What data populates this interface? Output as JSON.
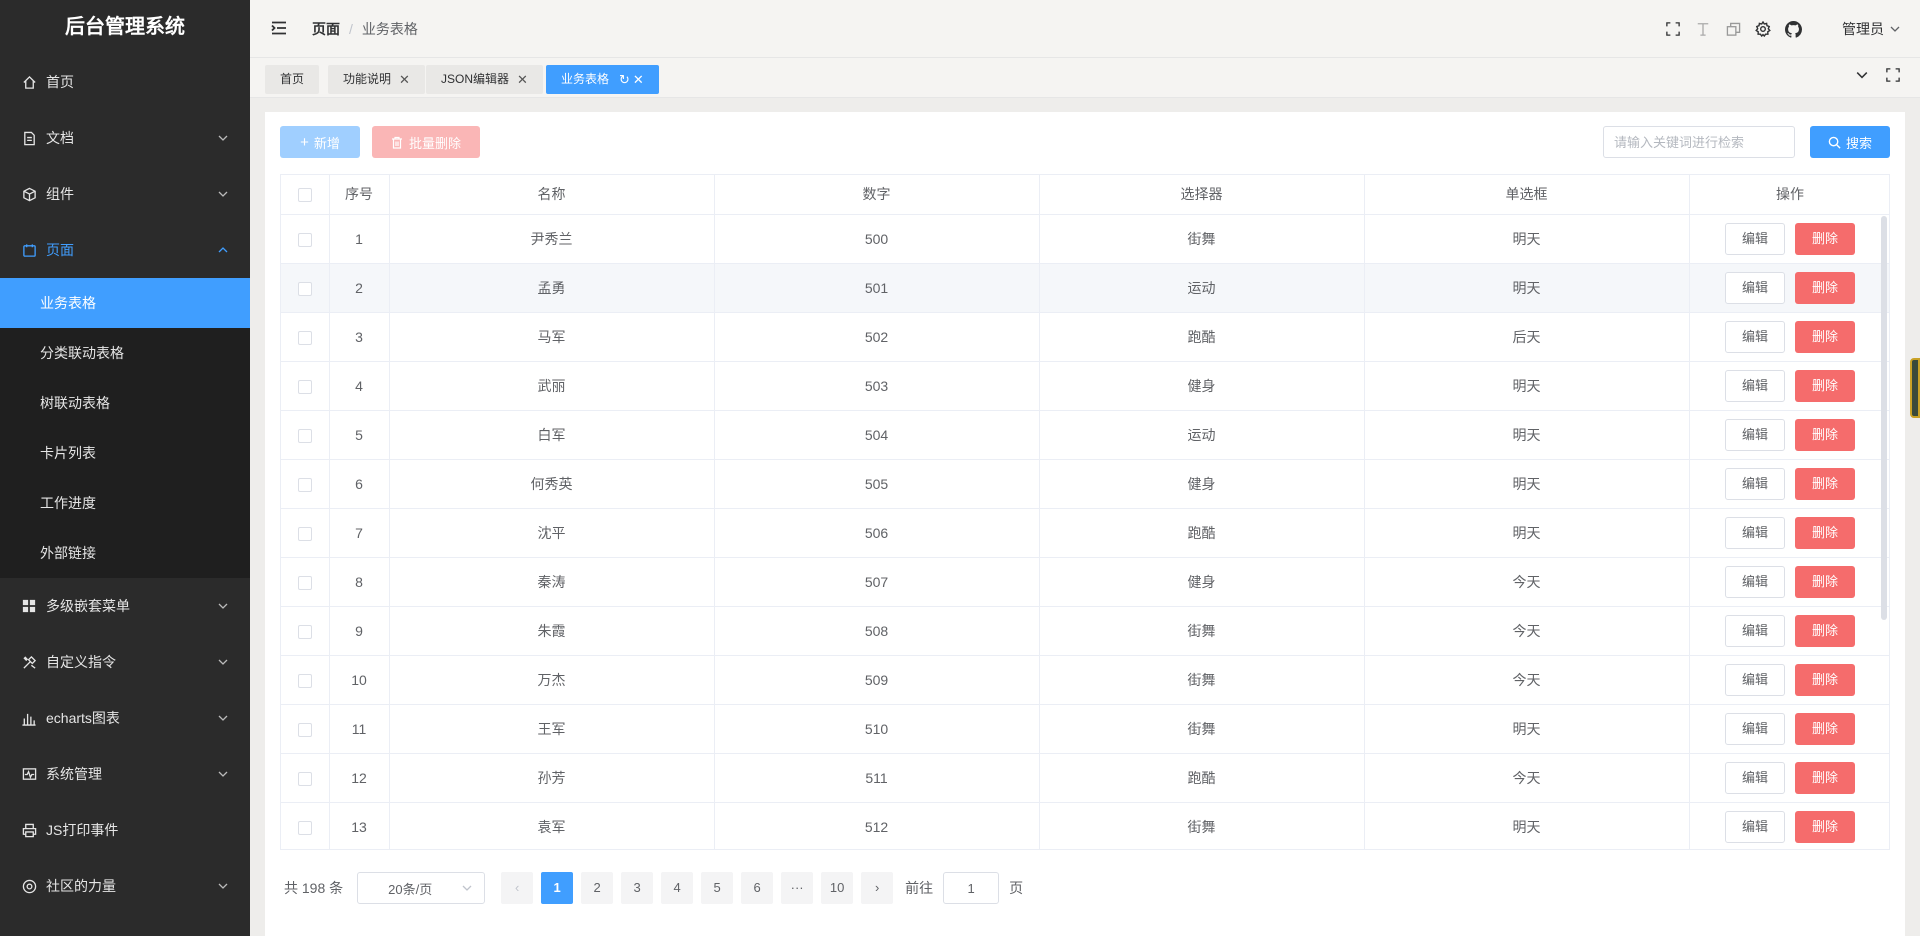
{
  "app": {
    "title": "后台管理系统"
  },
  "sidebar": {
    "items": [
      {
        "label": "首页",
        "icon": "home-icon"
      },
      {
        "label": "文档",
        "icon": "document-icon"
      },
      {
        "label": "组件",
        "icon": "cube-icon"
      },
      {
        "label": "页面",
        "icon": "page-icon"
      },
      {
        "label": "多级嵌套菜单",
        "icon": "grid-icon"
      },
      {
        "label": "自定义指令",
        "icon": "tools-icon"
      },
      {
        "label": "echarts图表",
        "icon": "bar-chart-icon"
      },
      {
        "label": "系统管理",
        "icon": "monitor-icon"
      },
      {
        "label": "JS打印事件",
        "icon": "printer-icon"
      },
      {
        "label": "社区的力量",
        "icon": "community-icon"
      }
    ],
    "sub_items": [
      "业务表格",
      "分类联动表格",
      "树联动表格",
      "卡片列表",
      "工作进度",
      "外部链接"
    ]
  },
  "header": {
    "breadcrumb": [
      "页面",
      "业务表格"
    ],
    "breadcrumb_sep": "/",
    "user": "管理员"
  },
  "tabs": [
    {
      "label": "首页"
    },
    {
      "label": "功能说明"
    },
    {
      "label": "JSON编辑器"
    },
    {
      "label": "业务表格"
    }
  ],
  "toolbar": {
    "add_label": "新增",
    "batch_delete_label": "批量删除",
    "search_placeholder": "请输入关键词进行检索",
    "search_label": "搜索"
  },
  "table": {
    "columns": [
      "序号",
      "名称",
      "数字",
      "选择器",
      "单选框",
      "操作"
    ],
    "rows": [
      {
        "index": "1",
        "name": "尹秀兰",
        "number": "500",
        "select": "街舞",
        "radio": "明天"
      },
      {
        "index": "2",
        "name": "孟勇",
        "number": "501",
        "select": "运动",
        "radio": "明天"
      },
      {
        "index": "3",
        "name": "马军",
        "number": "502",
        "select": "跑酷",
        "radio": "后天"
      },
      {
        "index": "4",
        "name": "武丽",
        "number": "503",
        "select": "健身",
        "radio": "明天"
      },
      {
        "index": "5",
        "name": "白军",
        "number": "504",
        "select": "运动",
        "radio": "明天"
      },
      {
        "index": "6",
        "name": "何秀英",
        "number": "505",
        "select": "健身",
        "radio": "明天"
      },
      {
        "index": "7",
        "name": "沈平",
        "number": "506",
        "select": "跑酷",
        "radio": "明天"
      },
      {
        "index": "8",
        "name": "秦涛",
        "number": "507",
        "select": "健身",
        "radio": "今天"
      },
      {
        "index": "9",
        "name": "朱霞",
        "number": "508",
        "select": "街舞",
        "radio": "今天"
      },
      {
        "index": "10",
        "name": "万杰",
        "number": "509",
        "select": "街舞",
        "radio": "今天"
      },
      {
        "index": "11",
        "name": "王军",
        "number": "510",
        "select": "街舞",
        "radio": "明天"
      },
      {
        "index": "12",
        "name": "孙芳",
        "number": "511",
        "select": "跑酷",
        "radio": "今天"
      },
      {
        "index": "13",
        "name": "袁军",
        "number": "512",
        "select": "街舞",
        "radio": "明天"
      }
    ],
    "edit_label": "编辑",
    "delete_label": "删除"
  },
  "pagination": {
    "total_text": "共 198 条",
    "page_size": "20条/页",
    "pages": [
      "1",
      "2",
      "3",
      "4",
      "5",
      "6",
      "10"
    ],
    "ellipsis": "···",
    "current": "1",
    "goto_prefix": "前往",
    "goto_value": "1",
    "goto_suffix": "页"
  },
  "colors": {
    "primary": "#409eff",
    "danger": "#f56c6c",
    "sidebar_bg": "#2b2b2b"
  }
}
